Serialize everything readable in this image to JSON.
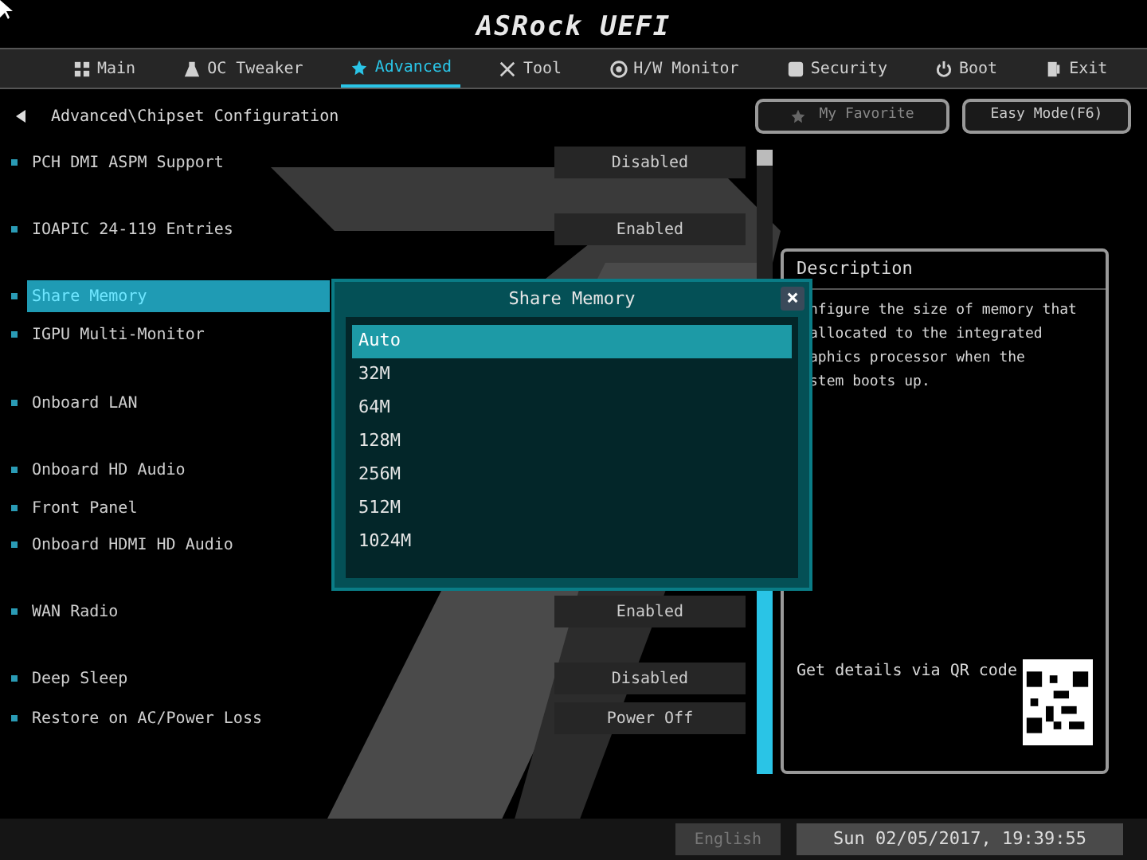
{
  "header": {
    "logo": "ASRock UEFI"
  },
  "tabs": [
    {
      "label": "Main",
      "kind": "grid",
      "selected": false
    },
    {
      "label": "OC Tweaker",
      "kind": "flask",
      "selected": false
    },
    {
      "label": "Advanced",
      "kind": "star",
      "selected": true
    },
    {
      "label": "Tool",
      "kind": "tools",
      "selected": false
    },
    {
      "label": "H/W Monitor",
      "kind": "monitor",
      "selected": false
    },
    {
      "label": "Security",
      "kind": "shield",
      "selected": false
    },
    {
      "label": "Boot",
      "kind": "power",
      "selected": false
    },
    {
      "label": "Exit",
      "kind": "door",
      "selected": false
    }
  ],
  "breadcrumb": "Advanced\\Chipset Configuration",
  "favorite_button": "My Favorite",
  "easy_mode_button": "Easy Mode(F6)",
  "settings": [
    {
      "label": "PCH DMI ASPM Support",
      "value": "Disabled",
      "selected": false
    },
    {
      "label": "IOAPIC 24-119 Entries",
      "value": "Enabled",
      "selected": false
    },
    {
      "label": "Share Memory",
      "selected": true
    },
    {
      "label": "IGPU Multi-Monitor",
      "selected": false
    },
    {
      "label": "Onboard LAN",
      "selected": false
    },
    {
      "label": "Onboard HD Audio",
      "selected": false
    },
    {
      "label": "Front Panel",
      "selected": false
    },
    {
      "label": "Onboard HDMI HD Audio",
      "selected": false
    },
    {
      "label": "WAN Radio",
      "value": "Enabled",
      "selected": false
    },
    {
      "label": "Deep Sleep",
      "value": "Disabled",
      "selected": false
    },
    {
      "label": "Restore on AC/Power Loss",
      "value": "Power Off",
      "selected": false
    }
  ],
  "dialog": {
    "title": "Share Memory",
    "close": "×",
    "options": [
      {
        "label": "Auto",
        "selected": true
      },
      {
        "label": "32M",
        "selected": false
      },
      {
        "label": "64M",
        "selected": false
      },
      {
        "label": "128M",
        "selected": false
      },
      {
        "label": "256M",
        "selected": false
      },
      {
        "label": "512M",
        "selected": false
      },
      {
        "label": "1024M",
        "selected": false
      }
    ]
  },
  "description": {
    "title": "Description",
    "lines": [
      "nfigure the size of memory that",
      "allocated to the integrated",
      "aphics processor when the",
      "stem boots up."
    ],
    "qr_text": "Get details via QR code"
  },
  "status_bar": {
    "language": "English",
    "datetime": "Sun 02/05/2017, 19:39:55"
  }
}
